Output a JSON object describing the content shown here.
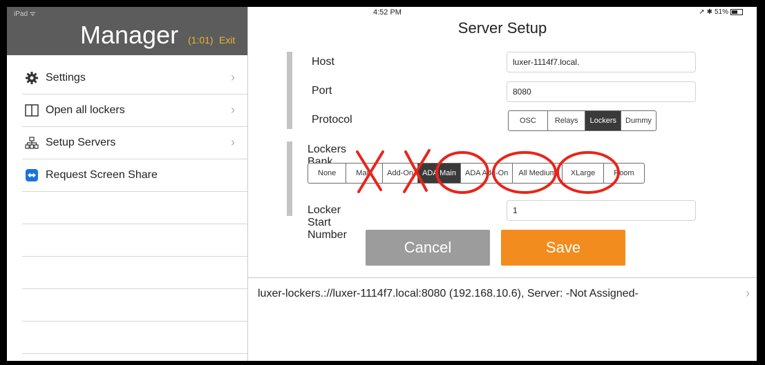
{
  "status": {
    "device": "iPad",
    "time": "4:52 PM",
    "battery": "51%"
  },
  "sidebar": {
    "title": "Manager",
    "timer": "(1:01)",
    "exit": "Exit",
    "items": [
      {
        "label": "Settings",
        "icon": "gear-icon"
      },
      {
        "label": "Open all lockers",
        "icon": "locker-icon"
      },
      {
        "label": "Setup Servers",
        "icon": "network-icon"
      },
      {
        "label": "Request Screen Share",
        "icon": "screen-share-icon"
      }
    ]
  },
  "main": {
    "title": "Server Setup",
    "host_label": "Host",
    "host_value": "luxer-1114f7.local.",
    "port_label": "Port",
    "port_value": "8080",
    "protocol_label": "Protocol",
    "protocol_options": [
      "OSC",
      "Relays",
      "Lockers",
      "Dummy"
    ],
    "protocol_selected": "Lockers",
    "bank_label": "Lockers Bank",
    "bank_options": [
      "None",
      "Main",
      "Add-On",
      "ADA Main",
      "ADA Add-On",
      "All Medium",
      "XLarge",
      "Room"
    ],
    "bank_selected": "ADA Main",
    "start_label": "Locker Start Number",
    "start_value": "1",
    "cancel": "Cancel",
    "save": "Save",
    "server_row": "luxer-lockers.://luxer-1114f7.local:8080 (192.168.10.6), Server: -Not Assigned-"
  },
  "colors": {
    "accent": "#f28c1e",
    "header": "#5c5c5c",
    "annotation": "#e8251b"
  }
}
